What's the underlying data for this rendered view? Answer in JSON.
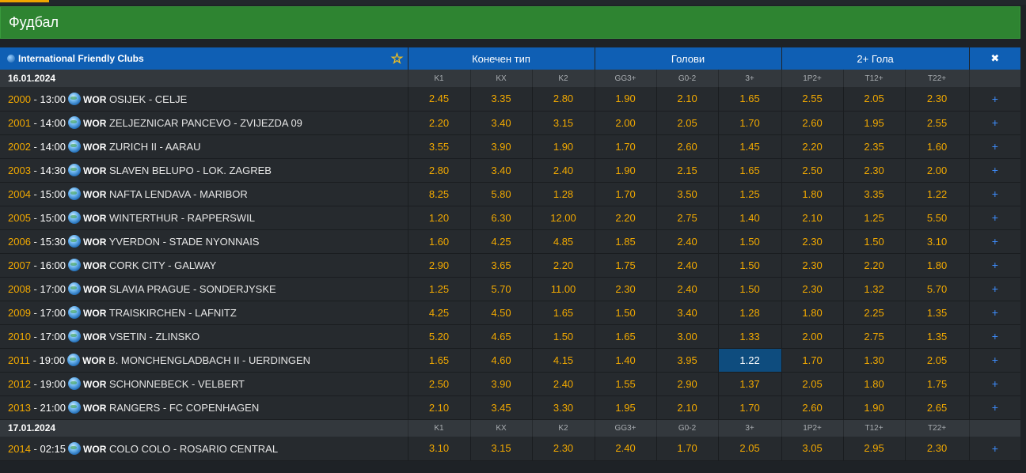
{
  "sport_title": "Фудбал",
  "league": {
    "name": "International Friendly Clubs",
    "icon": "league-globe-icon"
  },
  "groups": {
    "final": "Конечен тип",
    "goals": "Голови",
    "two_plus": "2+ Гола",
    "close": "✖"
  },
  "cols": [
    "K1",
    "KX",
    "K2",
    "GG3+",
    "G0-2",
    "3+",
    "1P2+",
    "T12+",
    "T22+"
  ],
  "dates": [
    {
      "label": "16.01.2024",
      "matches": [
        {
          "code": "2000",
          "time": "13:00",
          "wor": "WOR",
          "teams": "OSIJEK - CELJE",
          "odds": [
            "2.45",
            "3.35",
            "2.80",
            "1.90",
            "2.10",
            "1.65",
            "2.55",
            "2.05",
            "2.30"
          ]
        },
        {
          "code": "2001",
          "time": "14:00",
          "wor": "WOR",
          "teams": "ZELJEZNICAR PANCEVO - ZVIJEZDA 09",
          "odds": [
            "2.20",
            "3.40",
            "3.15",
            "2.00",
            "2.05",
            "1.70",
            "2.60",
            "1.95",
            "2.55"
          ]
        },
        {
          "code": "2002",
          "time": "14:00",
          "wor": "WOR",
          "teams": "ZURICH II - AARAU",
          "odds": [
            "3.55",
            "3.90",
            "1.90",
            "1.70",
            "2.60",
            "1.45",
            "2.20",
            "2.35",
            "1.60"
          ]
        },
        {
          "code": "2003",
          "time": "14:30",
          "wor": "WOR",
          "teams": "SLAVEN BELUPO - LOK. ZAGREB",
          "odds": [
            "2.80",
            "3.40",
            "2.40",
            "1.90",
            "2.15",
            "1.65",
            "2.50",
            "2.30",
            "2.00"
          ]
        },
        {
          "code": "2004",
          "time": "15:00",
          "wor": "WOR",
          "teams": "NAFTA LENDAVA - MARIBOR",
          "odds": [
            "8.25",
            "5.80",
            "1.28",
            "1.70",
            "3.50",
            "1.25",
            "1.80",
            "3.35",
            "1.22"
          ]
        },
        {
          "code": "2005",
          "time": "15:00",
          "wor": "WOR",
          "teams": "WINTERTHUR - RAPPERSWIL",
          "odds": [
            "1.20",
            "6.30",
            "12.00",
            "2.20",
            "2.75",
            "1.40",
            "2.10",
            "1.25",
            "5.50"
          ]
        },
        {
          "code": "2006",
          "time": "15:30",
          "wor": "WOR",
          "teams": "YVERDON - STADE NYONNAIS",
          "odds": [
            "1.60",
            "4.25",
            "4.85",
            "1.85",
            "2.40",
            "1.50",
            "2.30",
            "1.50",
            "3.10"
          ]
        },
        {
          "code": "2007",
          "time": "16:00",
          "wor": "WOR",
          "teams": "CORK CITY - GALWAY",
          "odds": [
            "2.90",
            "3.65",
            "2.20",
            "1.75",
            "2.40",
            "1.50",
            "2.30",
            "2.20",
            "1.80"
          ]
        },
        {
          "code": "2008",
          "time": "17:00",
          "wor": "WOR",
          "teams": "SLAVIA PRAGUE - SONDERJYSKE",
          "odds": [
            "1.25",
            "5.70",
            "11.00",
            "2.30",
            "2.40",
            "1.50",
            "2.30",
            "1.32",
            "5.70"
          ]
        },
        {
          "code": "2009",
          "time": "17:00",
          "wor": "WOR",
          "teams": "TRAISKIRCHEN - LAFNITZ",
          "odds": [
            "4.25",
            "4.50",
            "1.65",
            "1.50",
            "3.40",
            "1.28",
            "1.80",
            "2.25",
            "1.35"
          ]
        },
        {
          "code": "2010",
          "time": "17:00",
          "wor": "WOR",
          "teams": "VSETIN - ZLINSKO",
          "odds": [
            "5.20",
            "4.65",
            "1.50",
            "1.65",
            "3.00",
            "1.33",
            "2.00",
            "2.75",
            "1.35"
          ]
        },
        {
          "code": "2011",
          "time": "19:00",
          "wor": "WOR",
          "teams": "B. MONCHENGLADBACH II - UERDINGEN",
          "odds": [
            "1.65",
            "4.60",
            "4.15",
            "1.40",
            "3.95",
            "1.22",
            "1.70",
            "1.30",
            "2.05"
          ],
          "selected": 5
        },
        {
          "code": "2012",
          "time": "19:00",
          "wor": "WOR",
          "teams": "SCHONNEBECK - VELBERT",
          "odds": [
            "2.50",
            "3.90",
            "2.40",
            "1.55",
            "2.90",
            "1.37",
            "2.05",
            "1.80",
            "1.75"
          ]
        },
        {
          "code": "2013",
          "time": "21:00",
          "wor": "WOR",
          "teams": "RANGERS - FC COPENHAGEN",
          "odds": [
            "2.10",
            "3.45",
            "3.30",
            "1.95",
            "2.10",
            "1.70",
            "2.60",
            "1.90",
            "2.65"
          ]
        }
      ]
    },
    {
      "label": "17.01.2024",
      "matches": [
        {
          "code": "2014",
          "time": "02:15",
          "wor": "WOR",
          "teams": "COLO COLO - ROSARIO CENTRAL",
          "odds": [
            "3.10",
            "3.15",
            "2.30",
            "2.40",
            "1.70",
            "2.05",
            "3.05",
            "2.95",
            "2.30"
          ]
        }
      ]
    }
  ],
  "more_label": "+",
  "colors": {
    "header_green": "#2e8431",
    "header_blue": "#0f5fb4",
    "odds": "#f2a900",
    "selected": "#0e4c7e"
  }
}
